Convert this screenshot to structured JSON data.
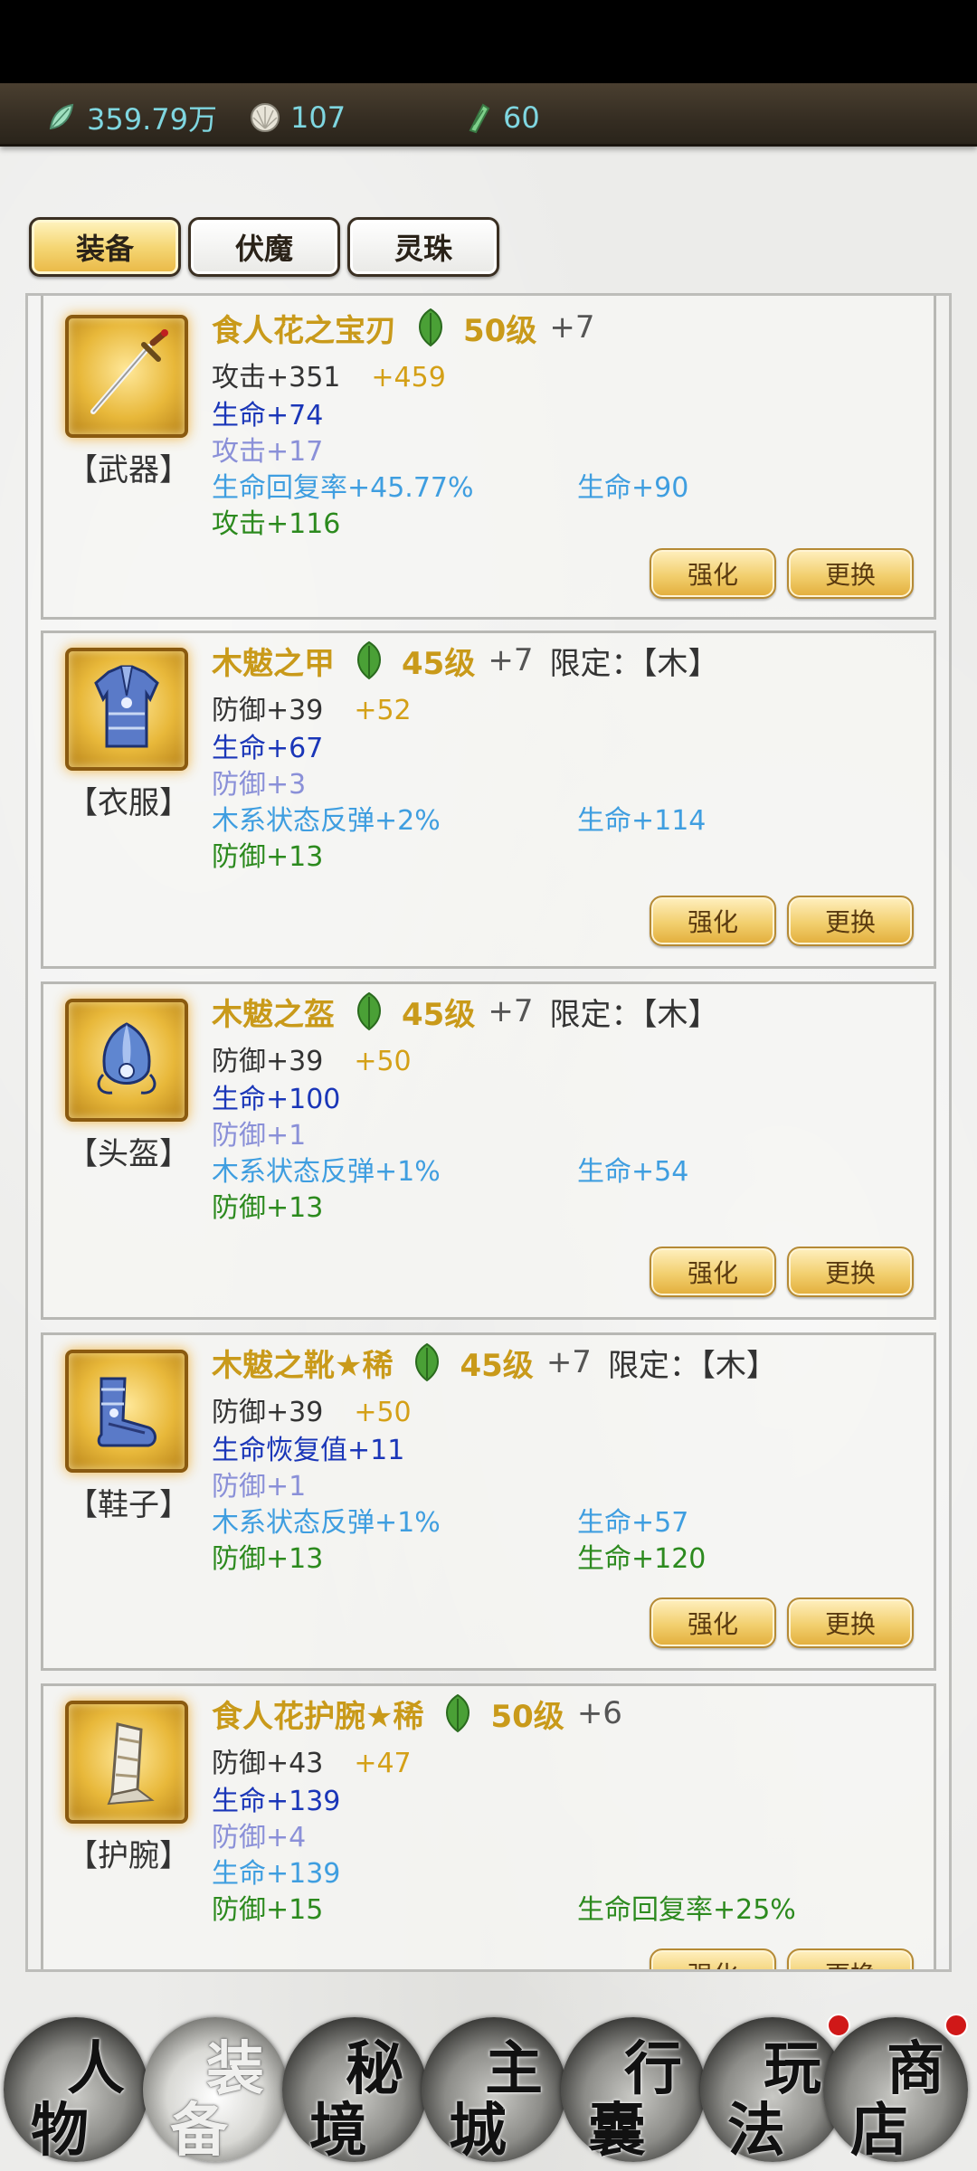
{
  "currency": {
    "jade": {
      "value": "359.79万",
      "icon": "jade-leaf-icon"
    },
    "pearl": {
      "value": "107",
      "icon": "pearl-shell-icon"
    },
    "token": {
      "value": "60",
      "icon": "jade-token-icon"
    }
  },
  "tabs": [
    {
      "label": "装备",
      "active": true
    },
    {
      "label": "伏魔",
      "active": false
    },
    {
      "label": "灵珠",
      "active": false
    }
  ],
  "buttons": {
    "strengthen": "强化",
    "replace": "更换"
  },
  "items": [
    {
      "slot": "【武器】",
      "icon": "sword-icon",
      "name": "食人花之宝刃",
      "level": "50级",
      "plus": "+7",
      "limit": "",
      "stats": [
        {
          "text": "攻击+351",
          "bonus": "+459"
        },
        {
          "text": "生命+74"
        },
        {
          "text": "攻击+17"
        },
        {
          "text": "生命回复率+45.77%",
          "right": "生命+90"
        },
        {
          "text": "攻击+116"
        }
      ]
    },
    {
      "slot": "【衣服】",
      "icon": "armor-icon",
      "name": "木魃之甲",
      "level": "45级",
      "plus": "+7",
      "limit": "限定：【木】",
      "stats": [
        {
          "text": "防御+39",
          "bonus": "+52"
        },
        {
          "text": "生命+67"
        },
        {
          "text": "防御+3"
        },
        {
          "text": "木系状态反弹+2%",
          "right": "生命+114"
        },
        {
          "text": "防御+13"
        }
      ]
    },
    {
      "slot": "【头盔】",
      "icon": "helmet-icon",
      "name": "木魃之盔",
      "level": "45级",
      "plus": "+7",
      "limit": "限定：【木】",
      "stats": [
        {
          "text": "防御+39",
          "bonus": "+50"
        },
        {
          "text": "生命+100"
        },
        {
          "text": "防御+1"
        },
        {
          "text": "木系状态反弹+1%",
          "right": "生命+54"
        },
        {
          "text": "防御+13"
        }
      ]
    },
    {
      "slot": "【鞋子】",
      "icon": "boots-icon",
      "name": "木魃之靴★稀",
      "level": "45级",
      "plus": "+7",
      "limit": "限定：【木】",
      "stats": [
        {
          "text": "防御+39",
          "bonus": "+50"
        },
        {
          "text": "生命恢复值+11"
        },
        {
          "text": "防御+1"
        },
        {
          "text": "木系状态反弹+1%",
          "right": "生命+57"
        },
        {
          "text": "防御+13",
          "right": "生命+120"
        }
      ]
    },
    {
      "slot": "【护腕】",
      "icon": "bracer-icon",
      "name": "食人花护腕★稀",
      "level": "50级",
      "plus": "+6",
      "limit": "",
      "stats": [
        {
          "text": "防御+43",
          "bonus": "+47"
        },
        {
          "text": "生命+139"
        },
        {
          "text": "防御+4"
        },
        {
          "text": "生命+139"
        },
        {
          "text": "防御+15",
          "right": "生命回复率+25%"
        }
      ]
    }
  ],
  "nav": [
    {
      "c1": "人",
      "c2": "物",
      "active": false,
      "dot": false
    },
    {
      "c1": "装",
      "c2": "备",
      "active": true,
      "dot": false
    },
    {
      "c1": "秘",
      "c2": "境",
      "active": false,
      "dot": false
    },
    {
      "c1": "主",
      "c2": "城",
      "active": false,
      "dot": false
    },
    {
      "c1": "行",
      "c2": "囊",
      "active": false,
      "dot": false
    },
    {
      "c1": "玩",
      "c2": "法",
      "active": false,
      "dot": true
    },
    {
      "c1": "商",
      "c2": "店",
      "active": false,
      "dot": true
    }
  ],
  "colors": {
    "name_gold": "#c99a1a",
    "bonus_gold": "#d4a017",
    "stat_blue": "#1a36b8",
    "stat_lavender": "#8a90d8",
    "stat_sky": "#3f9ee0",
    "stat_green": "#2c8a1e",
    "currency_cyan": "#7fd6e0",
    "red_dot": "#d01818"
  }
}
